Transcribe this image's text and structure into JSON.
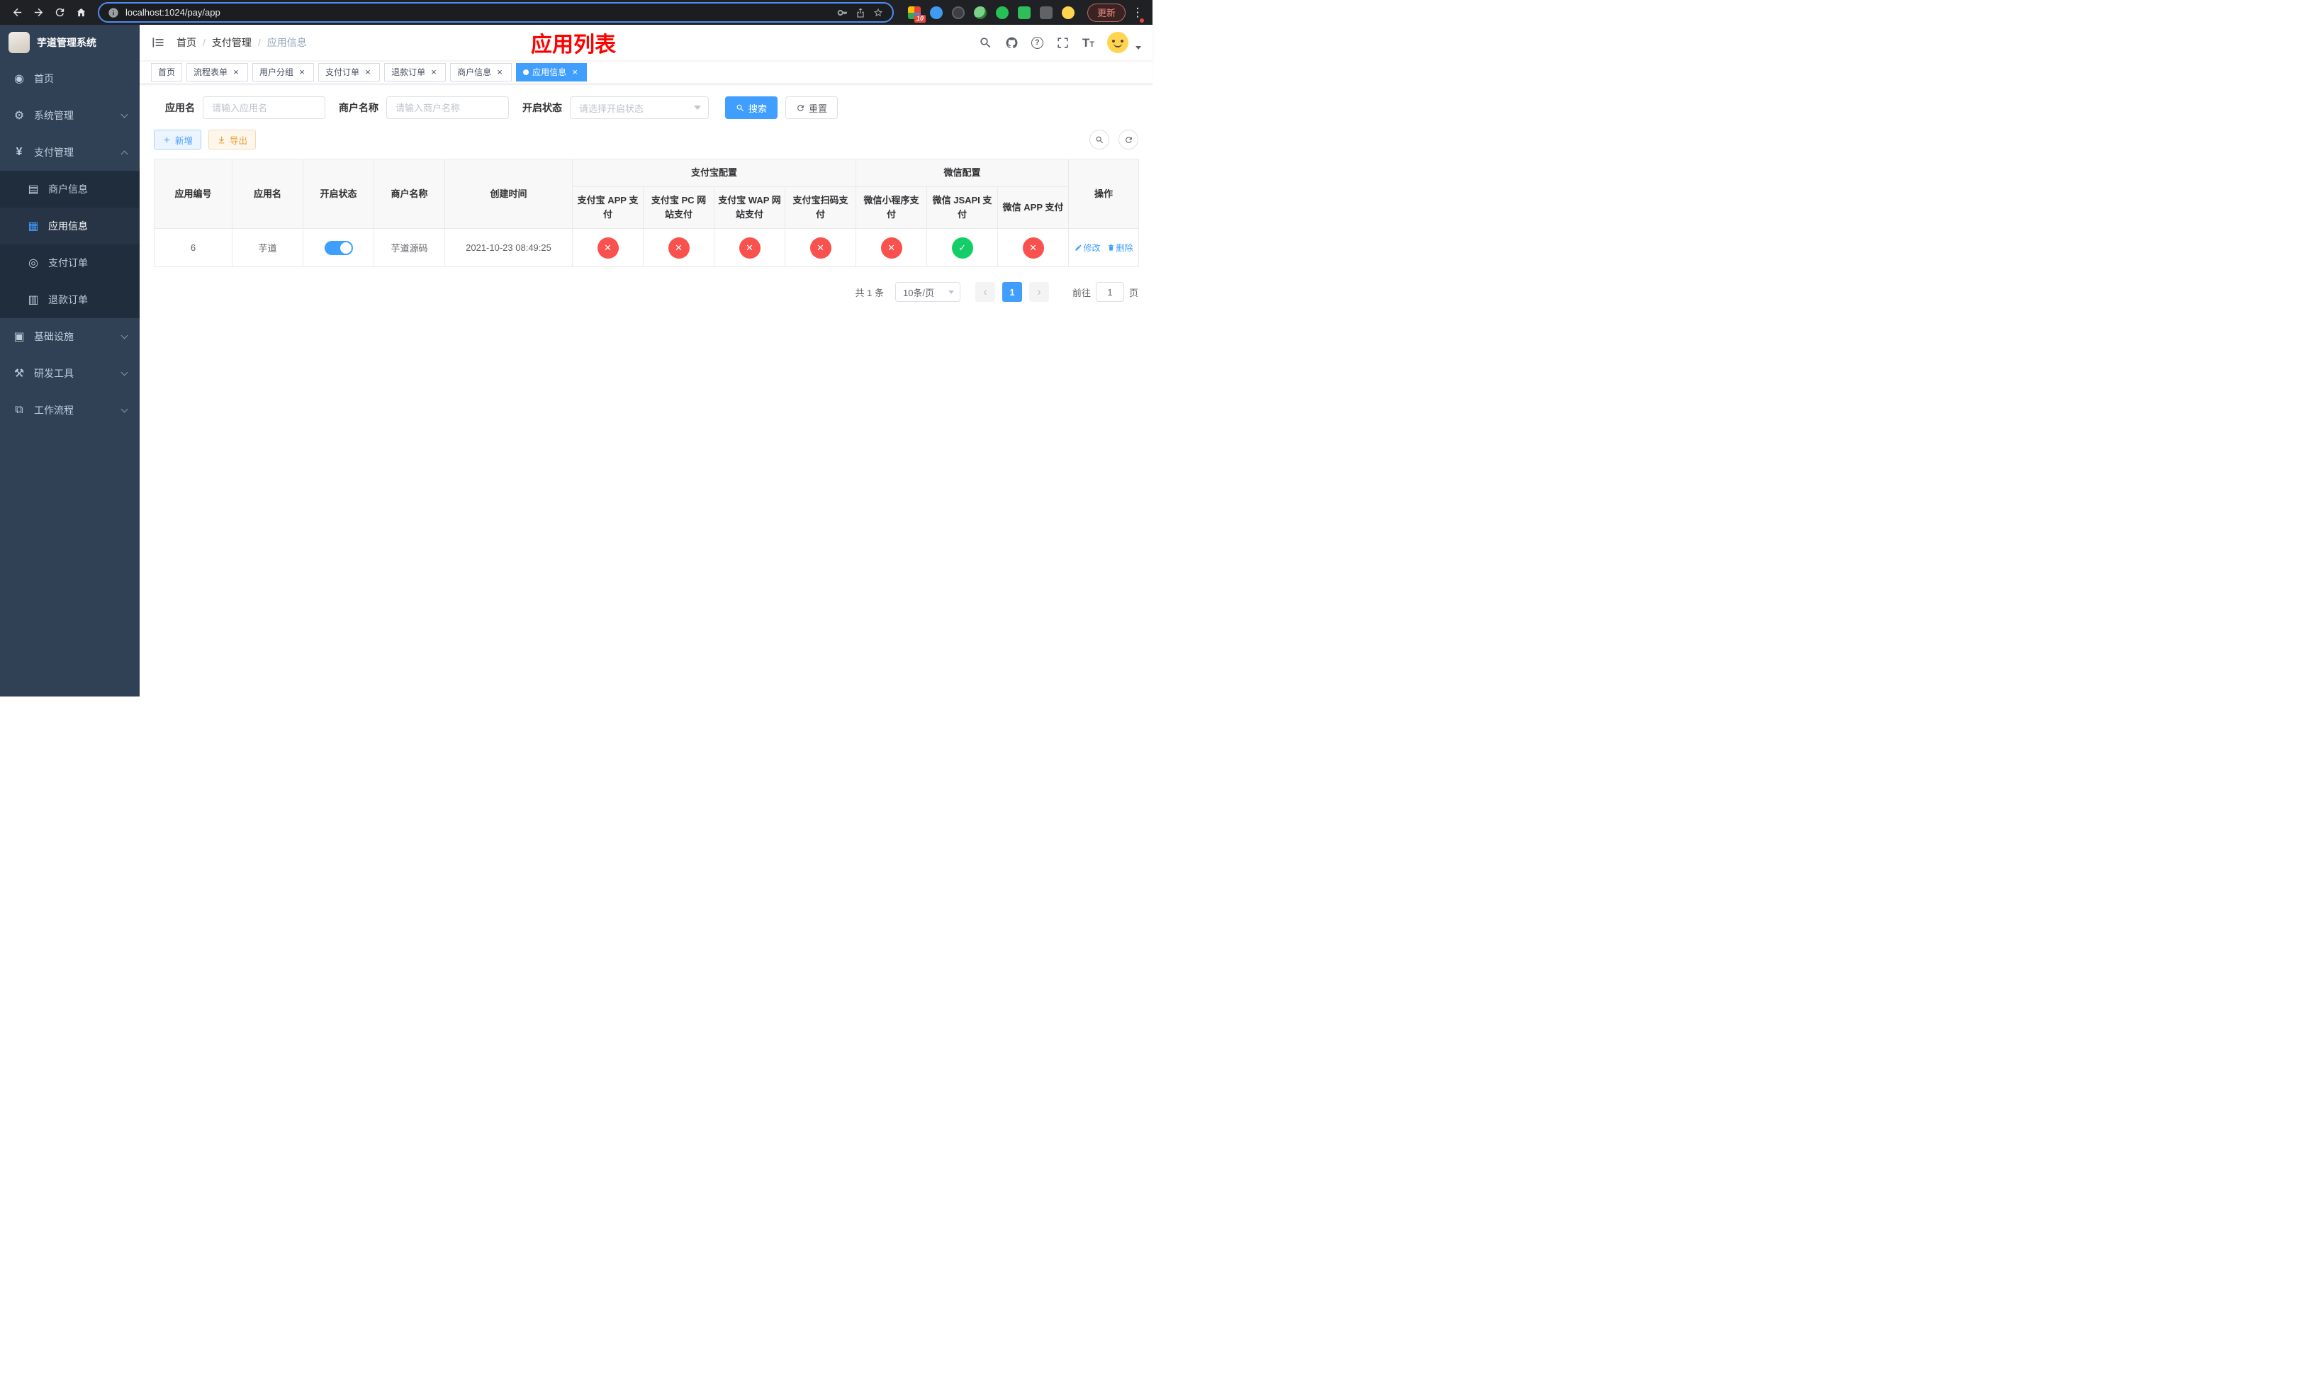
{
  "colors": {
    "primary": "#409eff",
    "success": "#13ce66",
    "danger": "#f9514e",
    "warning": "#e6a23c",
    "page_title_red": "#ff0000",
    "sidebar_bg": "#304156",
    "submenu_bg": "#1f2d3d"
  },
  "browser": {
    "url": "localhost:1024/pay/app",
    "update_label": "更新",
    "extension_badge": "10"
  },
  "sidebar": {
    "title": "芋道管理系统",
    "items": {
      "home": "首页",
      "system": "系统管理",
      "payment": "支付管理",
      "infra": "基础设施",
      "devtools": "研发工具",
      "workflow": "工作流程"
    },
    "payment_children": {
      "merchant": "商户信息",
      "app": "应用信息",
      "order": "支付订单",
      "refund": "退款订单"
    }
  },
  "header": {
    "breadcrumb": [
      "首页",
      "支付管理",
      "应用信息"
    ],
    "separator": "/",
    "page_title": "应用列表"
  },
  "tabs": [
    {
      "label": "首页"
    },
    {
      "label": "流程表单"
    },
    {
      "label": "用户分组"
    },
    {
      "label": "支付订单"
    },
    {
      "label": "退款订单"
    },
    {
      "label": "商户信息"
    },
    {
      "label": "应用信息"
    }
  ],
  "filters": {
    "app_name_label": "应用名",
    "app_name_placeholder": "请输入应用名",
    "merchant_label": "商户名称",
    "merchant_placeholder": "请输入商户名称",
    "status_label": "开启状态",
    "status_placeholder": "请选择开启状态",
    "search_label": "搜索",
    "reset_label": "重置"
  },
  "toolbar": {
    "add_label": "新增",
    "export_label": "导出"
  },
  "table": {
    "headers": {
      "app_id": "应用编号",
      "app_name": "应用名",
      "status": "开启状态",
      "merchant": "商户名称",
      "created": "创建时间",
      "alipay_group": "支付宝配置",
      "wechat_group": "微信配置",
      "alipay_app": "支付宝 APP 支付",
      "alipay_pc": "支付宝 PC 网站支付",
      "alipay_wap": "支付宝 WAP 网站支付",
      "alipay_qr": "支付宝扫码支付",
      "wechat_mini": "微信小程序支付",
      "wechat_jsapi": "微信 JSAPI 支付",
      "wechat_app": "微信 APP 支付",
      "actions": "操作"
    },
    "rows": [
      {
        "app_id": "6",
        "app_name": "芋道",
        "status_on": true,
        "merchant": "芋道源码",
        "created": "2021-10-23 08:49:25",
        "alipay_app": false,
        "alipay_pc": false,
        "alipay_wap": false,
        "alipay_qr": false,
        "wechat_mini": false,
        "wechat_jsapi": true,
        "wechat_app": false,
        "edit_label": "修改",
        "delete_label": "删除"
      }
    ]
  },
  "pagination": {
    "total_text": "共 1 条",
    "page_size": "10条/页",
    "current_page": "1",
    "goto_label": "前往",
    "goto_value": "1",
    "page_unit": "页"
  },
  "glyphs": {
    "close": "×",
    "cross": "✕",
    "check": "✓",
    "prev": "‹",
    "next": "›",
    "kebab": "⋮",
    "question": "?",
    "font_icon": "T",
    "dashboard_icon": "◉",
    "gear_icon": "⚙",
    "yen_icon": "¥",
    "merchant_icon": "▤",
    "app_icon": "▦",
    "order_icon": "◎",
    "refund_icon": "▥",
    "infra_icon": "▣",
    "tools_icon": "⚒",
    "workflow_icon": "⧉"
  }
}
